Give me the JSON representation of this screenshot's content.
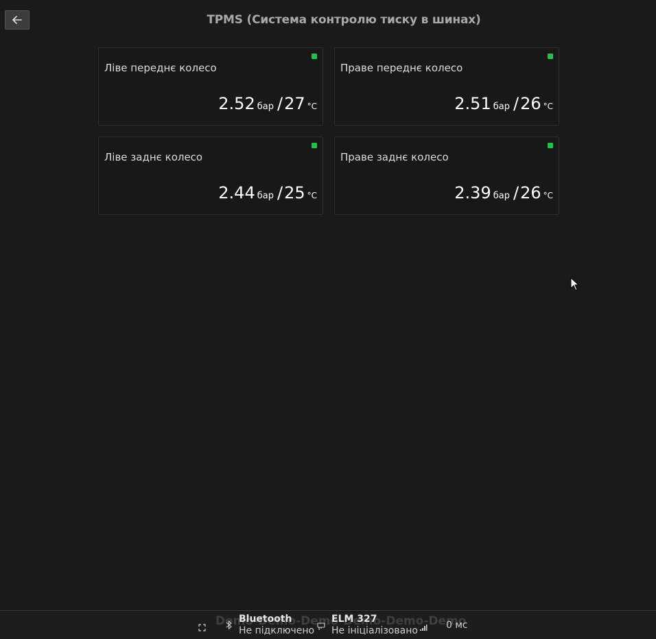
{
  "header": {
    "title": "TPMS (Система контролю тиску в шинах)",
    "back_icon": "arrow-left-icon"
  },
  "tires": [
    {
      "name": "Ліве переднє колесо",
      "pressure": "2.52",
      "pressure_unit": "бар",
      "separator": "/",
      "temperature": "27",
      "temperature_unit": "°C",
      "status_color": "#22c04a"
    },
    {
      "name": "Праве переднє колесо",
      "pressure": "2.51",
      "pressure_unit": "бар",
      "separator": "/",
      "temperature": "26",
      "temperature_unit": "°C",
      "status_color": "#22c04a"
    },
    {
      "name": "Ліве заднє колесо",
      "pressure": "2.44",
      "pressure_unit": "бар",
      "separator": "/",
      "temperature": "25",
      "temperature_unit": "°C",
      "status_color": "#22c04a"
    },
    {
      "name": "Праве заднє колесо",
      "pressure": "2.39",
      "pressure_unit": "бар",
      "separator": "/",
      "temperature": "26",
      "temperature_unit": "°C",
      "status_color": "#22c04a"
    }
  ],
  "statusbar": {
    "watermark": "Demo-Demo-Demo-Demo-Demo-Demo",
    "bluetooth": {
      "title": "Bluetooth",
      "status": "Не підключено",
      "icon": "bluetooth-icon"
    },
    "elm": {
      "title": "ELM 327",
      "status": "Не ініціалізовано",
      "icon": "car-adapter-icon"
    },
    "latency": "0 мс",
    "latency_icon": "signal-icon",
    "fullscreen_icon": "fullscreen-icon"
  }
}
